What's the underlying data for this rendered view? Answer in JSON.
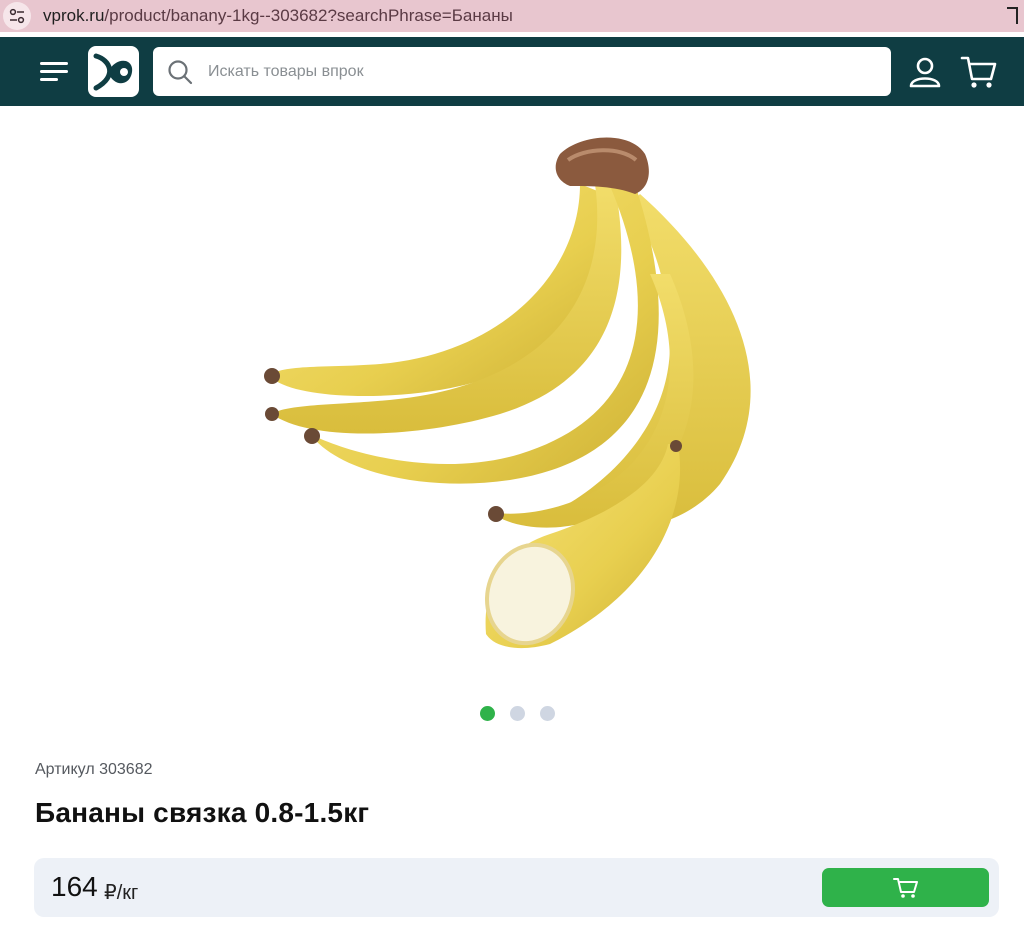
{
  "browser": {
    "url_host": "vprok.ru",
    "url_path": "/product/banany-1kg--303682?searchPhrase=Бананы",
    "site_info_icon": "tune-icon"
  },
  "header": {
    "background": "#0f3d43",
    "menu_icon": "hamburger-icon",
    "logo_icon": "vprok-logo",
    "search": {
      "placeholder": "Искать товары впрок",
      "value": "",
      "icon": "search-icon"
    },
    "profile_icon": "user-icon",
    "cart_icon": "cart-icon"
  },
  "product": {
    "image_icon": "banana-bunch-image",
    "gallery": {
      "total": 3,
      "active_index": 0
    },
    "article": "Артикул 303682",
    "title": "Бананы связка 0.8-1.5кг",
    "price": "164",
    "unit": "₽/кг",
    "add_to_cart_icon": "cart-icon",
    "accent_color": "#2fb24a"
  }
}
